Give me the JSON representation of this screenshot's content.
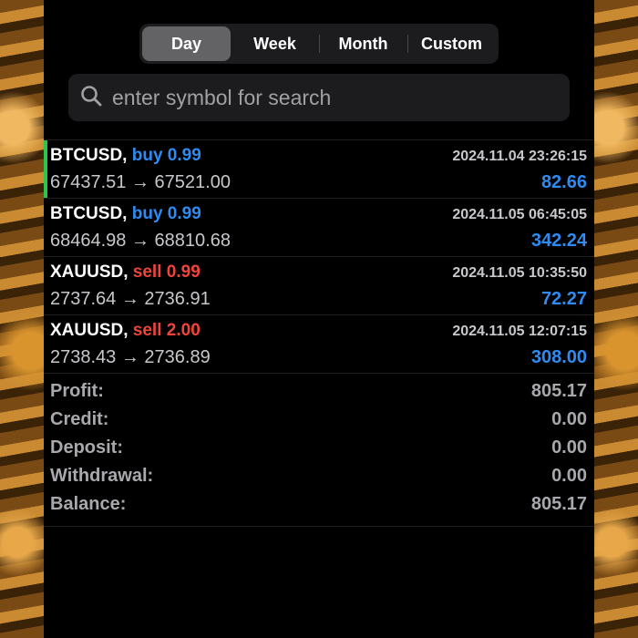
{
  "period_tabs": [
    {
      "label": "Day",
      "active": true
    },
    {
      "label": "Week",
      "active": false
    },
    {
      "label": "Month",
      "active": false
    },
    {
      "label": "Custom",
      "active": false
    }
  ],
  "search": {
    "placeholder": "enter symbol for search",
    "value": ""
  },
  "deals": [
    {
      "symbol": "BTCUSD,",
      "side": "buy",
      "volume": "0.99",
      "time": "2024.11.04 23:26:15",
      "prices": "67437.51 → 67521.00",
      "profit": "82.66"
    },
    {
      "symbol": "BTCUSD,",
      "side": "buy",
      "volume": "0.99",
      "time": "2024.11.05 06:45:05",
      "prices": "68464.98 → 68810.68",
      "profit": "342.24"
    },
    {
      "symbol": "XAUUSD,",
      "side": "sell",
      "volume": "0.99",
      "time": "2024.11.05 10:35:50",
      "prices": "2737.64 → 2736.91",
      "profit": "72.27"
    },
    {
      "symbol": "XAUUSD,",
      "side": "sell",
      "volume": "2.00",
      "time": "2024.11.05 12:07:15",
      "prices": "2738.43 → 2736.89",
      "profit": "308.00"
    }
  ],
  "summary": [
    {
      "label": "Profit:",
      "value": "805.17"
    },
    {
      "label": "Credit:",
      "value": "0.00"
    },
    {
      "label": "Deposit:",
      "value": "0.00"
    },
    {
      "label": "Withdrawal:",
      "value": "0.00"
    },
    {
      "label": "Balance:",
      "value": "805.17"
    }
  ],
  "colors": {
    "buy": "#2f8bf0",
    "sell": "#f0443a",
    "profit": "#2f8bf0",
    "selected_marker": "#2ec64a"
  }
}
